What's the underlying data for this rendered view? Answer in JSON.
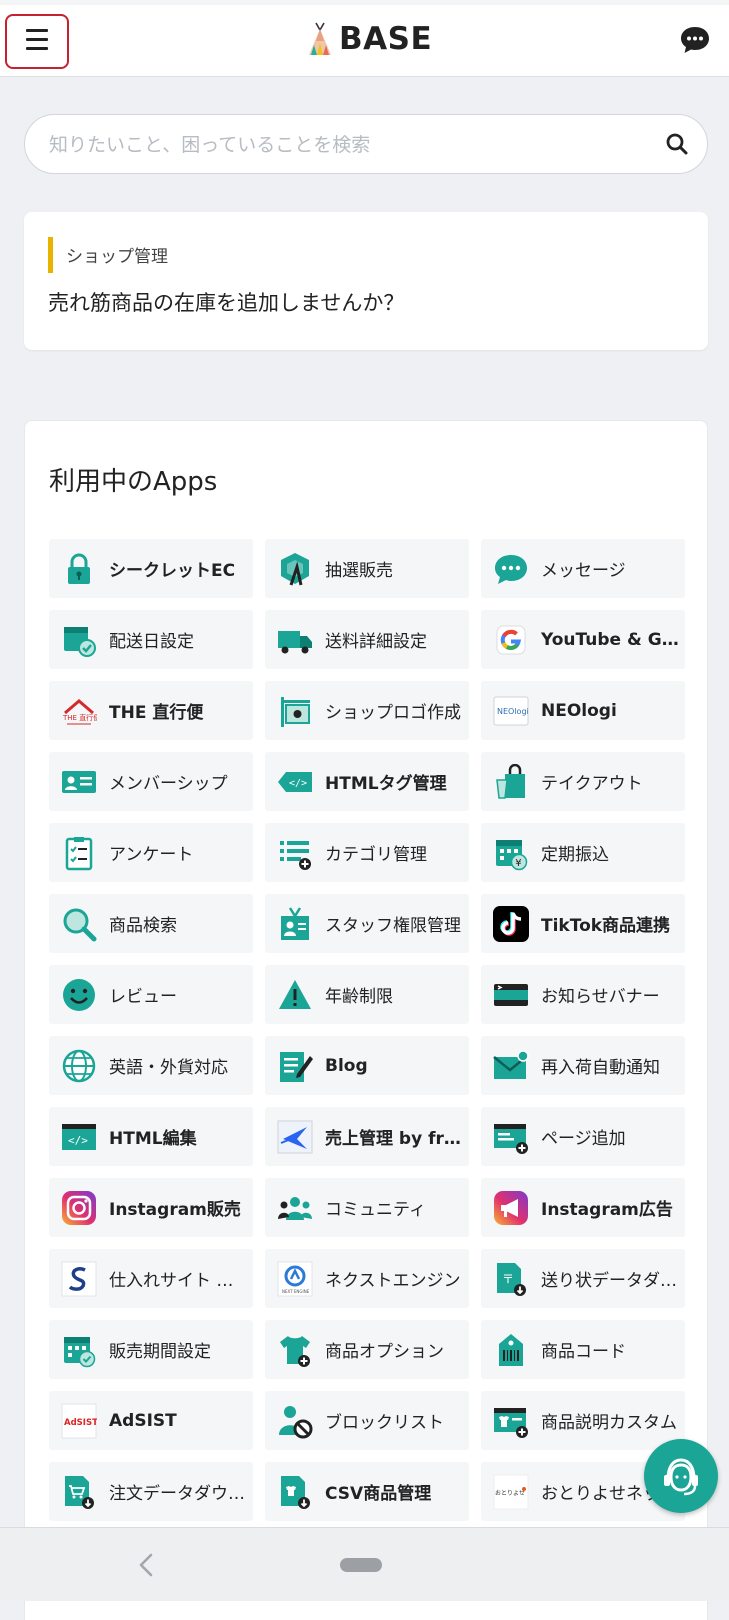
{
  "header": {
    "logo_text": "BASE",
    "menu_icon": "hamburger-icon",
    "chat_icon": "chat-bubble-icon"
  },
  "search": {
    "placeholder": "知りたいこと、困っていることを検索",
    "value": "",
    "icon": "search-icon"
  },
  "notice": {
    "category": "ショップ管理",
    "title": "売れ筋商品の在庫を追加しませんか？",
    "accent_color": "#e8b400"
  },
  "apps_section": {
    "title": "利用中のApps",
    "items": [
      {
        "label": "シークレットEC",
        "icon": "lock-icon"
      },
      {
        "label": "抽選販売",
        "icon": "lottery-icon"
      },
      {
        "label": "メッセージ",
        "icon": "message-icon"
      },
      {
        "label": "配送日設定",
        "icon": "delivery-date-icon"
      },
      {
        "label": "送料詳細設定",
        "icon": "truck-icon"
      },
      {
        "label": "YouTube & Google",
        "icon": "google-icon"
      },
      {
        "label": "THE 直行便",
        "icon": "chokkobin-logo-icon"
      },
      {
        "label": "ショップロゴ作成",
        "icon": "signboard-icon"
      },
      {
        "label": "NEOlogi",
        "icon": "neologi-logo-icon"
      },
      {
        "label": "メンバーシップ",
        "icon": "member-card-icon"
      },
      {
        "label": "HTMLタグ管理",
        "icon": "html-tag-icon"
      },
      {
        "label": "テイクアウト",
        "icon": "takeout-icon"
      },
      {
        "label": "アンケート",
        "icon": "survey-icon"
      },
      {
        "label": "カテゴリ管理",
        "icon": "category-icon"
      },
      {
        "label": "定期振込",
        "icon": "scheduled-transfer-icon"
      },
      {
        "label": "商品検索",
        "icon": "magnifier-icon"
      },
      {
        "label": "スタッフ権限管理",
        "icon": "staff-icon"
      },
      {
        "label": "TikTok商品連携",
        "icon": "tiktok-icon"
      },
      {
        "label": "レビュー",
        "icon": "smiley-icon"
      },
      {
        "label": "年齢制限",
        "icon": "warning-icon"
      },
      {
        "label": "お知らせバナー",
        "icon": "banner-icon"
      },
      {
        "label": "英語・外貨対応",
        "icon": "globe-icon"
      },
      {
        "label": "Blog",
        "icon": "blog-icon"
      },
      {
        "label": "再入荷自動通知",
        "icon": "mail-notify-icon"
      },
      {
        "label": "HTML編集",
        "icon": "html-edit-icon"
      },
      {
        "label": "売上管理 by freee",
        "icon": "freee-logo-icon"
      },
      {
        "label": "ページ追加",
        "icon": "add-page-icon"
      },
      {
        "label": "Instagram販売",
        "icon": "instagram-icon"
      },
      {
        "label": "コミュニティ",
        "icon": "community-icon"
      },
      {
        "label": "Instagram広告",
        "icon": "instagram-ads-icon"
      },
      {
        "label": "仕入れサイト スーパーデリバリー",
        "icon": "superdelivery-logo-icon"
      },
      {
        "label": "ネクストエンジン",
        "icon": "nextengine-logo-icon"
      },
      {
        "label": "送り状データダウンロード",
        "icon": "invoice-download-icon"
      },
      {
        "label": "販売期間設定",
        "icon": "sales-period-icon"
      },
      {
        "label": "商品オプション",
        "icon": "product-option-icon"
      },
      {
        "label": "商品コード",
        "icon": "product-code-icon"
      },
      {
        "label": "AdSIST",
        "icon": "adsist-logo-icon"
      },
      {
        "label": "ブロックリスト",
        "icon": "block-user-icon"
      },
      {
        "label": "商品説明カスタム",
        "icon": "description-custom-icon"
      },
      {
        "label": "注文データダウンロード",
        "icon": "order-download-icon"
      },
      {
        "label": "CSV商品管理",
        "icon": "csv-icon"
      },
      {
        "label": "おとりよせネット",
        "icon": "otoriyose-logo-icon"
      }
    ]
  },
  "support_fab": {
    "icon": "support-agent-icon"
  },
  "system_nav": {
    "back_icon": "back-chevron-icon",
    "home_icon": "home-pill-icon"
  },
  "colors": {
    "teal": "#1aa597",
    "tile_bg": "#f4f6f8",
    "page_bg": "#eef0f3"
  }
}
